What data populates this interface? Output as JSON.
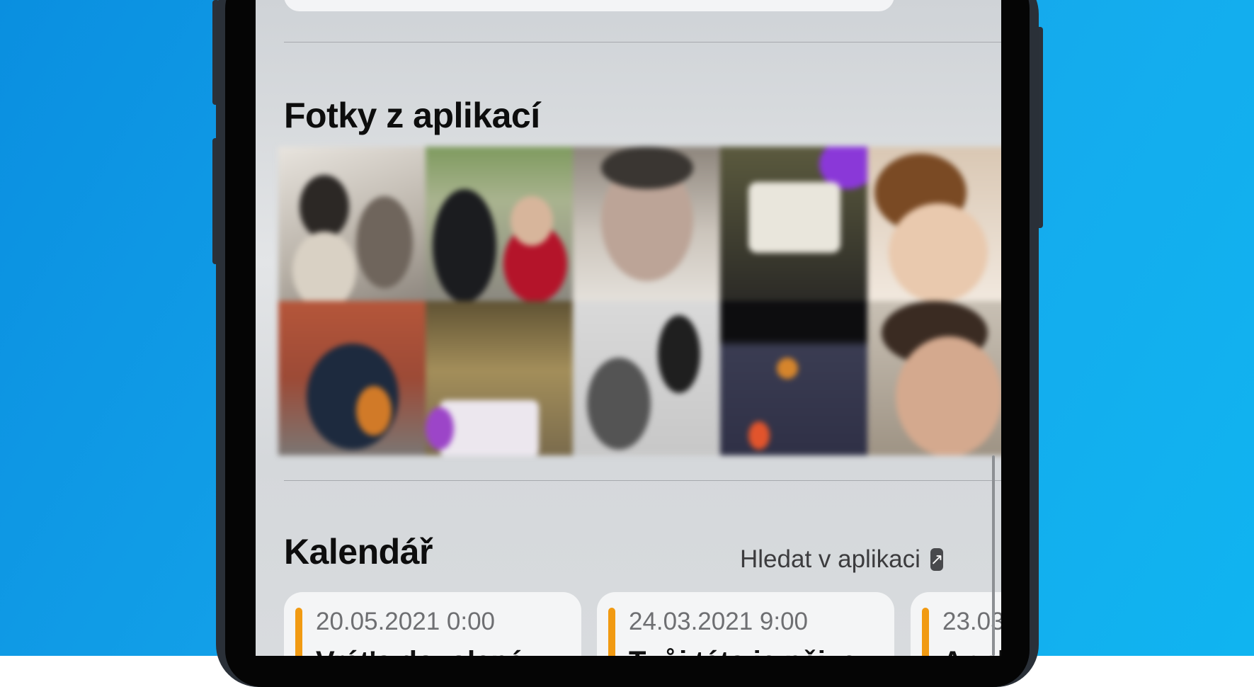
{
  "colors": {
    "background": "#10a0e8",
    "accent_event": "#f19a12",
    "section_title": "#0d0d0d"
  },
  "photos_section": {
    "title": "Fotky z aplikací"
  },
  "calendar_section": {
    "title": "Kalendář",
    "search_link": "Hledat v aplikaci",
    "search_icon": "arrow-up-right-square-icon",
    "events": [
      {
        "date": "20.05.2021 0:00",
        "title": "Vrát'a dovolená"
      },
      {
        "date": "24.03.2021 9:00",
        "title": "Tvůj táta je nějve"
      },
      {
        "date": "23.03",
        "title": "Appl"
      }
    ]
  }
}
